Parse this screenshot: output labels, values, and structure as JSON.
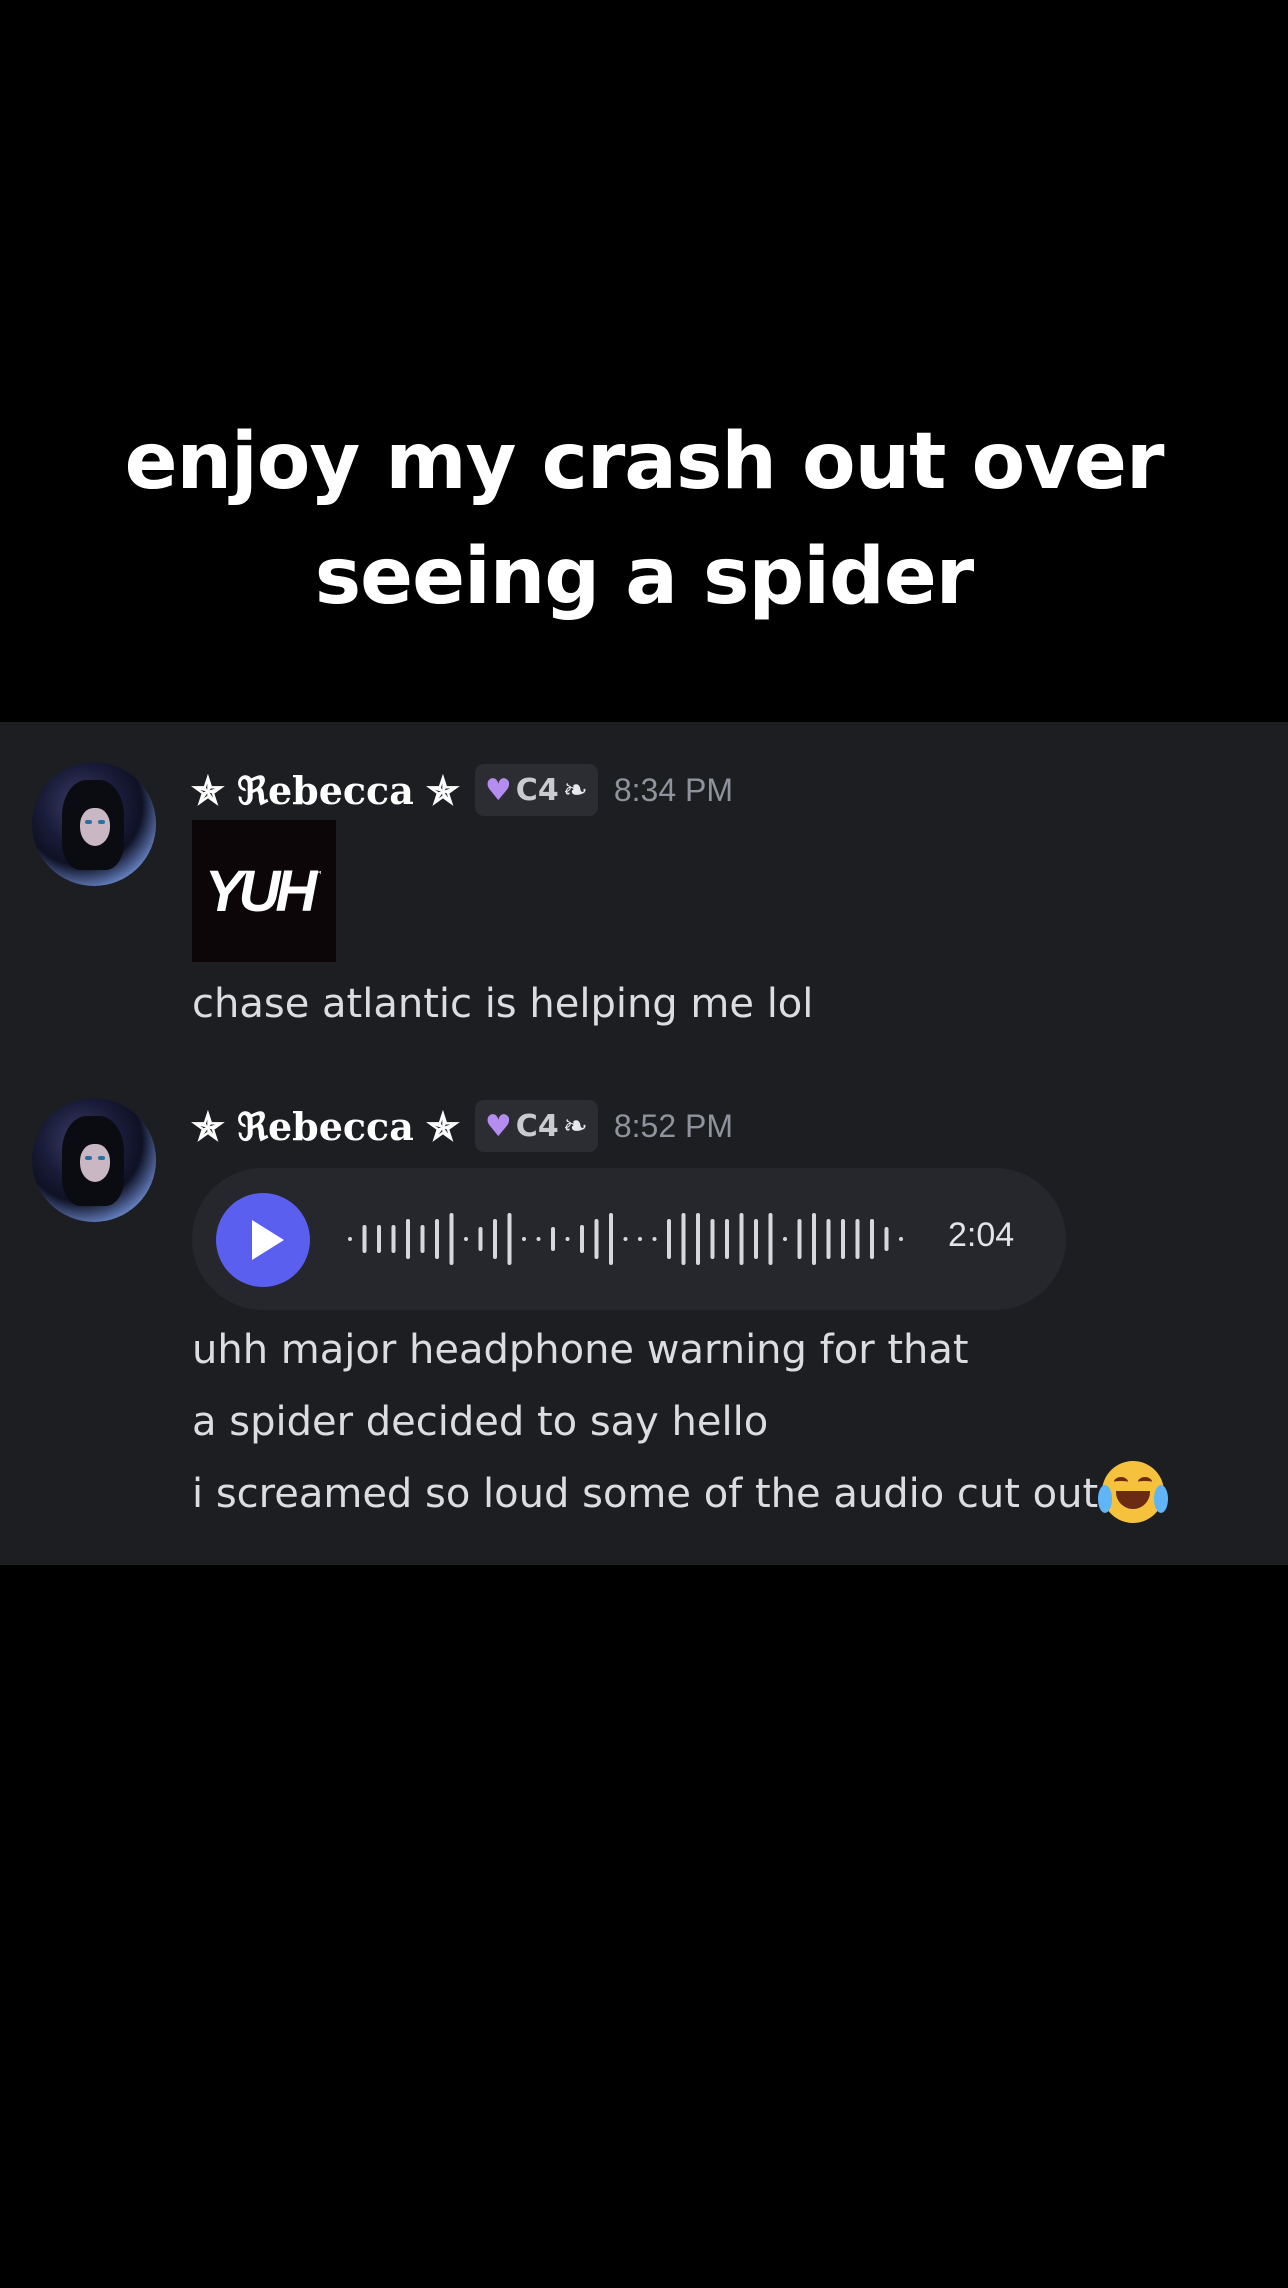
{
  "caption": {
    "line1": "enjoy my crash out over",
    "line2": "seeing a spider"
  },
  "messages": [
    {
      "username": "✯ ℜebecca ✯",
      "tag": "C4",
      "time": "8:34 PM",
      "image_text": "YUH",
      "image_tm": "™",
      "text": "chase atlantic is helping me lol"
    },
    {
      "username": "✯ ℜebecca ✯",
      "tag": "C4",
      "time": "8:52 PM",
      "voice": {
        "duration": "2:04"
      },
      "lines": [
        "uhh major headphone warning for that",
        "a spider decided to say hello",
        "i screamed so loud some of the audio cut out"
      ]
    }
  ],
  "icons": {
    "tag_heart": "purple-heart-icon",
    "tag_wing": "wing-icon",
    "play": "play-icon",
    "emoji": "crying-laughing-emoji"
  },
  "colors": {
    "background": "#000000",
    "chat_bg": "#1d1e22",
    "play_button": "#5b5ff0"
  }
}
